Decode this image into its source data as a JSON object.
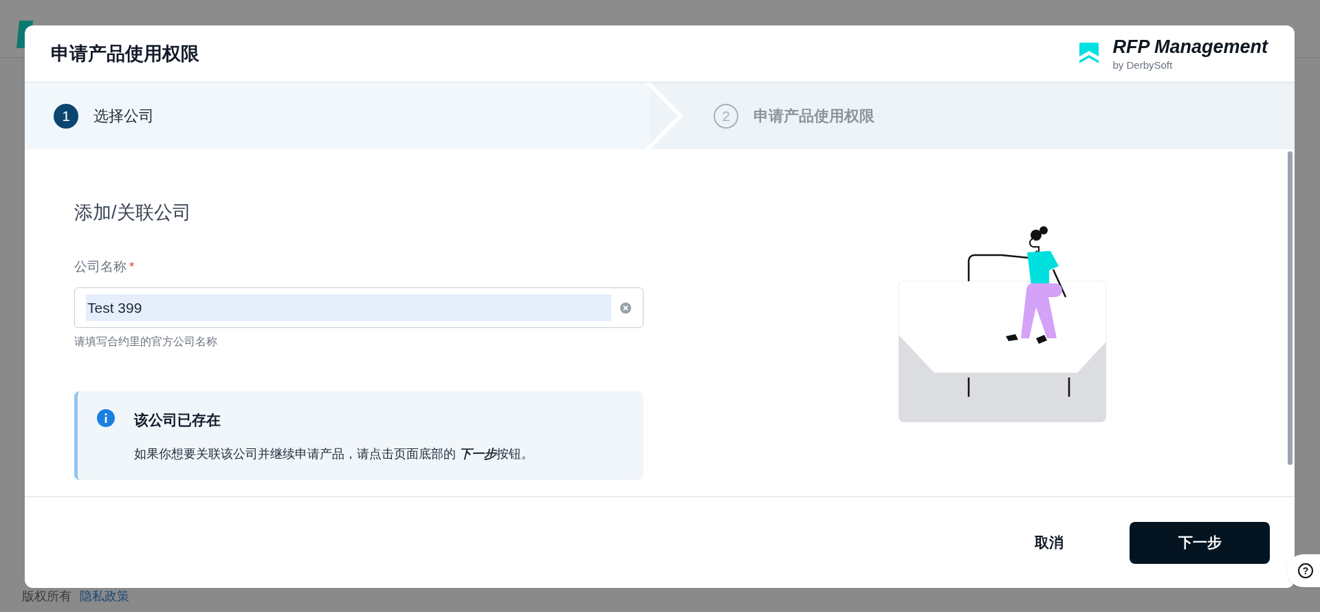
{
  "background": {
    "footer": {
      "copyright": "版权所有",
      "privacy_link": "隐私政策"
    }
  },
  "dialog": {
    "title": "申请产品使用权限",
    "brand": {
      "name": "RFP Management",
      "byline": "by DerbySoft"
    },
    "steps": [
      {
        "number": "1",
        "label": "选择公司",
        "selected": true
      },
      {
        "number": "2",
        "label": "申请产品使用权限",
        "selected": false
      }
    ],
    "section_title": "添加/关联公司",
    "field": {
      "label": "公司名称",
      "required": true,
      "required_mark": "*",
      "value": "Test 399",
      "helper": "请填写合约里的官方公司名称"
    },
    "alert": {
      "title": "该公司已存在",
      "message": "如果你想要关联该公司并继续申请产品，请点击页面底部的 ",
      "message_emphasis": "下一步",
      "message_end": "按钮。"
    },
    "buttons": {
      "cancel": "取消",
      "next": "下一步"
    }
  },
  "help_button": "?"
}
